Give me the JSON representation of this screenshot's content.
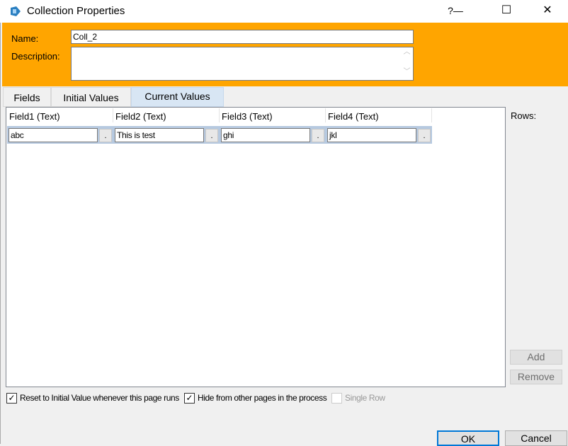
{
  "window": {
    "title": "Collection Properties",
    "help": "?",
    "minimize": "—",
    "maximize": "☐",
    "close": "✕"
  },
  "form": {
    "name_label": "Name:",
    "name_value": "Coll_2",
    "description_label": "Description:",
    "description_value": ""
  },
  "tabs": [
    {
      "label": "Fields"
    },
    {
      "label": "Initial Values"
    },
    {
      "label": "Current Values",
      "active": true
    }
  ],
  "grid": {
    "columns": [
      "Field1  (Text)",
      "Field2  (Text)",
      "Field3  (Text)",
      "Field4  (Text)"
    ],
    "rows": [
      [
        "abc",
        "This is test",
        "ghi",
        "jkl"
      ]
    ],
    "ellipsis": "."
  },
  "side": {
    "rows_label": "Rows:",
    "add_label": "Add",
    "remove_label": "Remove"
  },
  "options": [
    {
      "label": "Reset to Initial Value whenever this page runs",
      "checked": true
    },
    {
      "label": "Hide from other pages in the process",
      "checked": true
    },
    {
      "label": "Single Row",
      "checked": false,
      "disabled": true
    }
  ],
  "buttons": {
    "ok": "OK",
    "cancel": "Cancel"
  },
  "colors": {
    "header": "#ffa500",
    "selected_tab": "#d8e6f4",
    "row_highlight": "#b6c9e0"
  }
}
